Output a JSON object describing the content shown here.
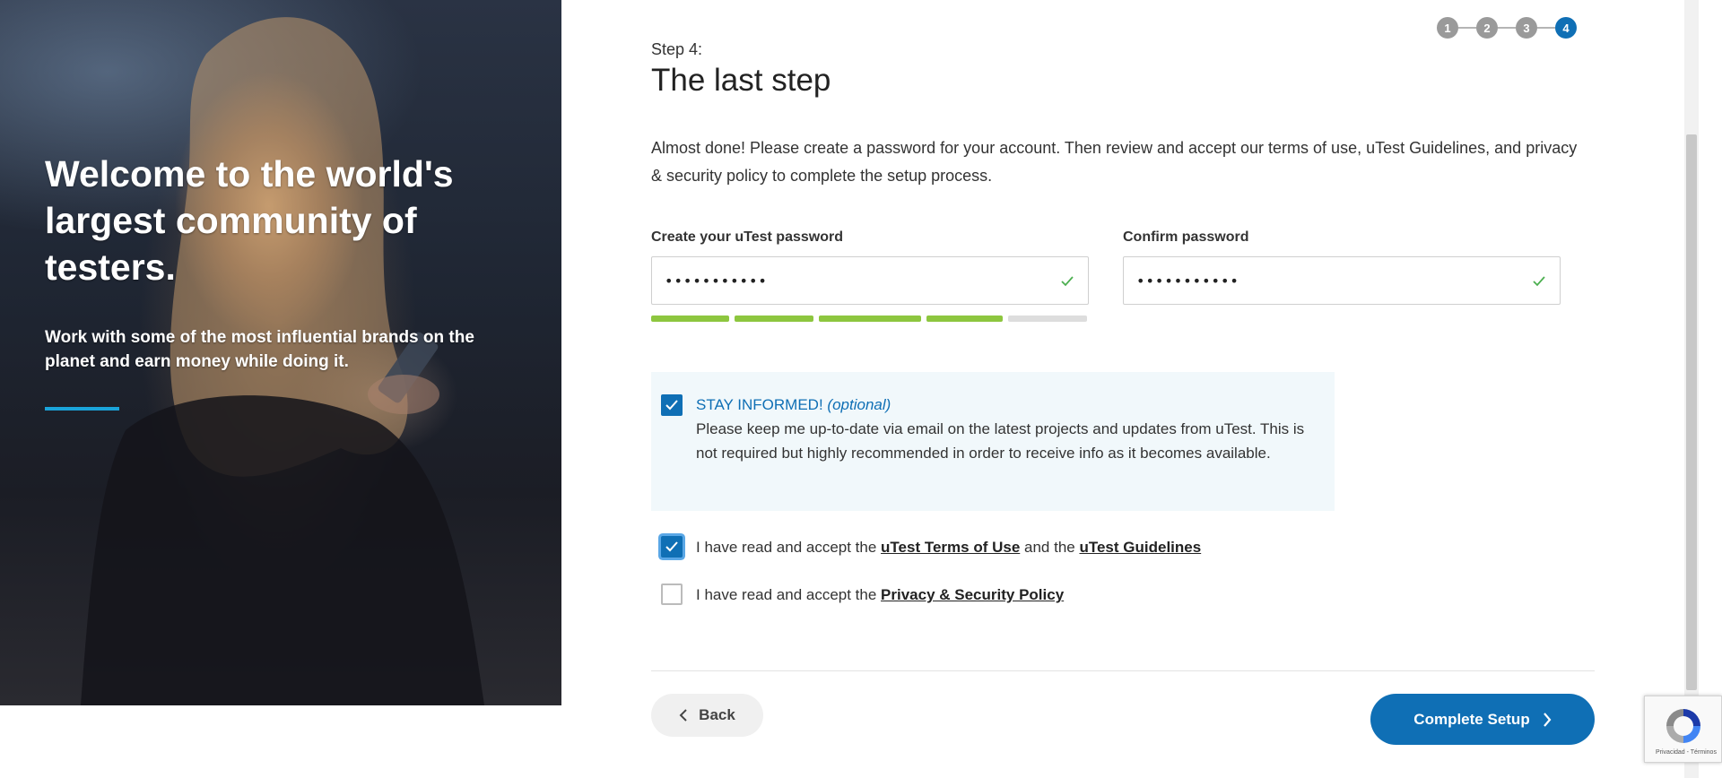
{
  "hero": {
    "title": "Welcome to the world's largest community of testers.",
    "subtitle": "Work with some of the most influential brands on the planet and earn money while doing it.",
    "accent_color": "#1aa3d9"
  },
  "stepper": {
    "steps": [
      "1",
      "2",
      "3",
      "4"
    ],
    "active_step": "4"
  },
  "header": {
    "step_label": "Step 4:",
    "title": "The last step"
  },
  "intro": "Almost done! Please create a password for your account. Then review and accept our terms of use, uTest Guidelines, and privacy & security policy to complete the setup process.",
  "password": {
    "label": "Create your uTest password",
    "value": "•••••••••••",
    "valid_icon": "check-icon",
    "strength_segments_filled": 4,
    "strength_segments_total": 5
  },
  "confirm": {
    "label": "Confirm password",
    "value": "•••••••••••",
    "valid_icon": "check-icon"
  },
  "stay_informed": {
    "title": "STAY INFORMED!",
    "optional": "(optional)",
    "text": "Please keep me up-to-date via email on the latest projects and updates from uTest. This is not required but highly recommended in order to receive info as it becomes available.",
    "checked": true
  },
  "terms": {
    "prefix": "I have read and accept the ",
    "link1": "uTest Terms of Use",
    "middle": " and the ",
    "link2": "uTest Guidelines",
    "checked": true
  },
  "privacy": {
    "prefix": "I have read and accept the ",
    "link": "Privacy & Security Policy",
    "checked": false
  },
  "buttons": {
    "back": "Back",
    "complete": "Complete Setup"
  },
  "recaptcha": {
    "footer": "Privacidad - Términos"
  },
  "colors": {
    "primary": "#0f6fb5",
    "strength_green": "#8dc63f",
    "strength_empty": "#dddddd",
    "valid_check": "#4caf50"
  }
}
